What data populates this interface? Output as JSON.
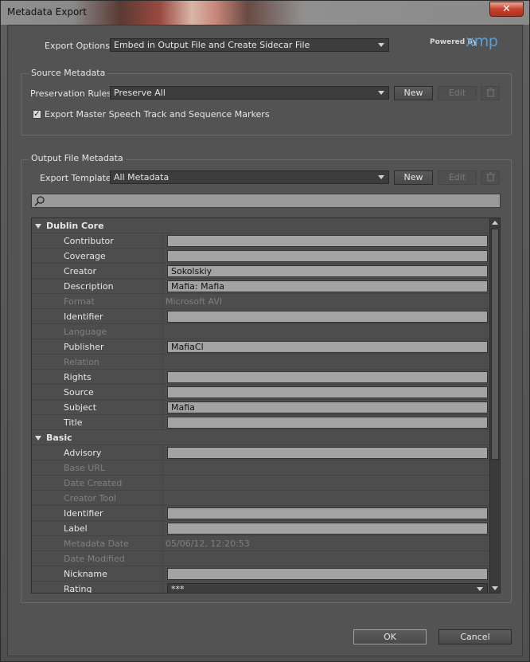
{
  "window": {
    "title": "Metadata Export",
    "close_label": "✕"
  },
  "export_options": {
    "label": "Export Options:",
    "value": "Embed in Output File and Create Sidecar File"
  },
  "branding": {
    "powered_by": "Powered By",
    "logo": "xmp",
    "logo_color": "#5a9fd8"
  },
  "source_metadata": {
    "title": "Source Metadata",
    "preservation_label": "Preservation Rules:",
    "preservation_value": "Preserve All",
    "new_label": "New",
    "edit_label": "Edit",
    "checkbox_label": "Export Master Speech Track and Sequence Markers",
    "checkbox_checked": true
  },
  "output_metadata": {
    "title": "Output File Metadata",
    "template_label": "Export Template:",
    "template_value": "All Metadata",
    "new_label": "New",
    "edit_label": "Edit",
    "search_placeholder": ""
  },
  "sections": [
    {
      "name": "Dublin Core",
      "rows": [
        {
          "key": "Contributor",
          "type": "field",
          "value": ""
        },
        {
          "key": "Coverage",
          "type": "field",
          "value": ""
        },
        {
          "key": "Creator",
          "type": "field",
          "value": "Sokolskiy"
        },
        {
          "key": "Description",
          "type": "field",
          "value": "Mafia: Mafia"
        },
        {
          "key": "Format",
          "type": "static",
          "value": "Microsoft AVI"
        },
        {
          "key": "Identifier",
          "type": "field",
          "value": ""
        },
        {
          "key": "Language",
          "type": "disabled",
          "value": ""
        },
        {
          "key": "Publisher",
          "type": "field",
          "value": "MafiaCl"
        },
        {
          "key": "Relation",
          "type": "disabled",
          "value": ""
        },
        {
          "key": "Rights",
          "type": "field",
          "value": ""
        },
        {
          "key": "Source",
          "type": "field",
          "value": ""
        },
        {
          "key": "Subject",
          "type": "field",
          "value": "Mafia"
        },
        {
          "key": "Title",
          "type": "field",
          "value": ""
        }
      ]
    },
    {
      "name": "Basic",
      "rows": [
        {
          "key": "Advisory",
          "type": "field",
          "value": ""
        },
        {
          "key": "Base URL",
          "type": "disabled",
          "value": ""
        },
        {
          "key": "Date Created",
          "type": "disabled",
          "value": ""
        },
        {
          "key": "Creator Tool",
          "type": "disabled",
          "value": ""
        },
        {
          "key": "Identifier",
          "type": "field",
          "value": ""
        },
        {
          "key": "Label",
          "type": "field",
          "value": ""
        },
        {
          "key": "Metadata Date",
          "type": "static",
          "value": "05/06/12, 12:20:53"
        },
        {
          "key": "Date Modified",
          "type": "disabled",
          "value": ""
        },
        {
          "key": "Nickname",
          "type": "field",
          "value": ""
        },
        {
          "key": "Rating",
          "type": "dropdown",
          "value": "***"
        }
      ]
    }
  ],
  "footer": {
    "ok_label": "OK",
    "cancel_label": "Cancel"
  }
}
